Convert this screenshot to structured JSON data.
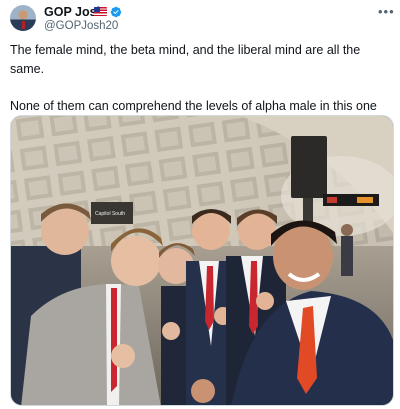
{
  "author": {
    "display_name": "GOP Josh",
    "handle": "@GOPJosh20",
    "flag_icon": "us-flag-icon",
    "verified_icon": "verified-badge-icon",
    "verified_color": "#1d9bf0"
  },
  "more_icon": "more-horizontal-icon",
  "tweet": {
    "line1": "The female mind, the beta mind, and the liberal mind are all the same.",
    "line2": "None of them can comprehend the levels of alpha male in this one photo."
  },
  "photo": {
    "sign_text": "Capitol South",
    "description_icon": "group-selfie-photo"
  }
}
